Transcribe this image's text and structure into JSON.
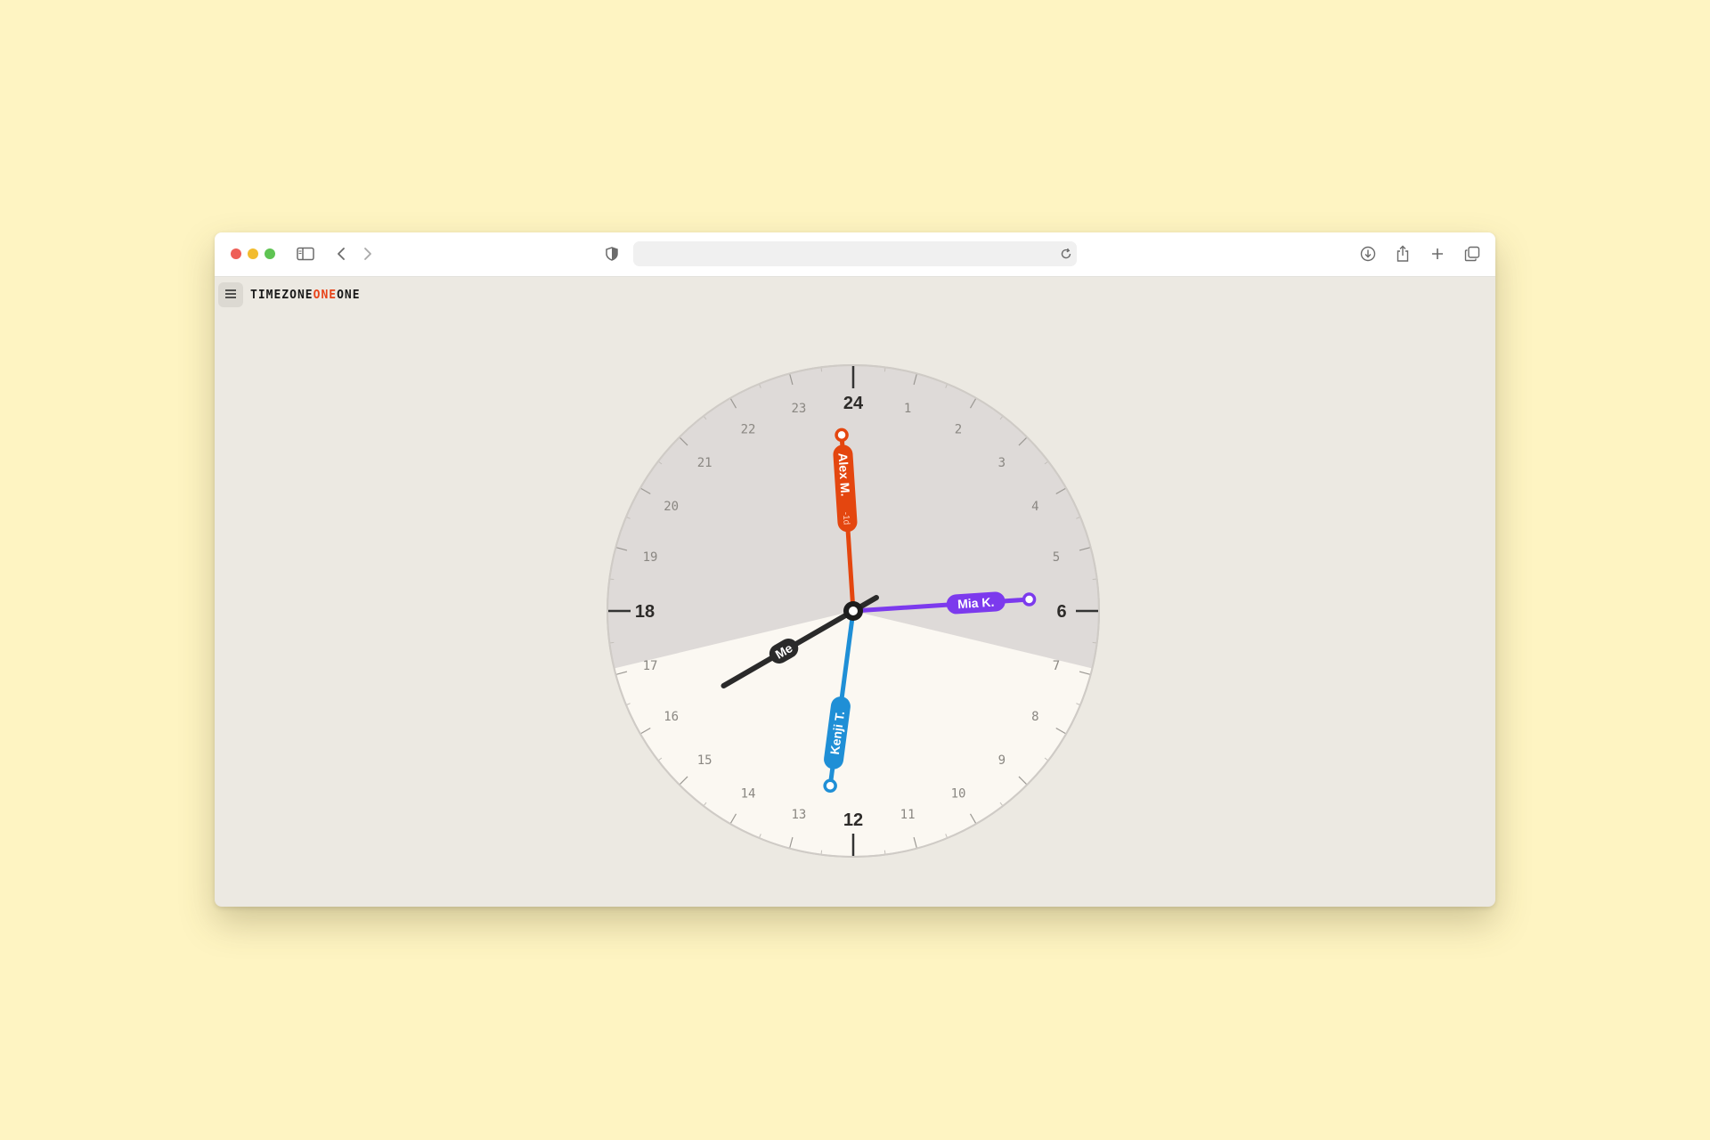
{
  "browser": {
    "address_value": "",
    "icons": [
      "sidebar-icon",
      "back-icon",
      "forward-icon",
      "shield-icon",
      "reload-icon",
      "download-icon",
      "share-icon",
      "new-tab-icon",
      "tabs-overview-icon"
    ]
  },
  "app": {
    "logo_part1": "TIMEZONE",
    "logo_part2": "ONE",
    "logo_part3": "ONE",
    "accent_color": "#e8441a"
  },
  "clock": {
    "hour_labels": [
      "24",
      "1",
      "2",
      "3",
      "4",
      "5",
      "6",
      "7",
      "8",
      "9",
      "10",
      "11",
      "12",
      "13",
      "14",
      "15",
      "16",
      "17",
      "18",
      "19",
      "20",
      "21",
      "22",
      "23"
    ],
    "major_hours": [
      24,
      6,
      12,
      18
    ],
    "night_color": "#dedad8",
    "day_color": "#fbf8f2",
    "people": [
      {
        "name": "Alex M.",
        "badge": "-1d",
        "hour": 23.75,
        "color": "#e4460f"
      },
      {
        "name": "Mia K.",
        "badge": "",
        "hour": 5.75,
        "color": "#7c3aed"
      },
      {
        "name": "Kenji T.",
        "badge": "",
        "hour": 12.5,
        "color": "#1f8fd6"
      },
      {
        "name": "Me",
        "badge": "",
        "hour": 16.0,
        "color": "#2a2a2a"
      }
    ]
  }
}
